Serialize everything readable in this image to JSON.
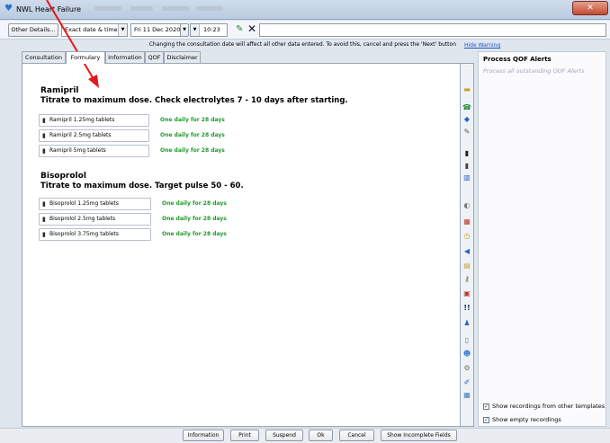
{
  "window": {
    "title": "NWL Heart Failure",
    "close_label": "✕"
  },
  "toolbar": {
    "other_details": "Other Details...",
    "date_type": "Exact date & time",
    "date": "Fri 11 Dec 2020",
    "time": "10:23"
  },
  "warning": {
    "text": "Changing the consultation date will affect all other data entered. To avoid this, cancel and press the 'Next' button",
    "hide_link": "Hide Warning"
  },
  "tabs": [
    {
      "label": "Consultation"
    },
    {
      "label": "Formulary"
    },
    {
      "label": "Information"
    },
    {
      "label": "QOF"
    },
    {
      "label": "Disclaimer"
    }
  ],
  "sections": [
    {
      "name": "Ramipril",
      "instruction": "Titrate to maximum dose. Check electrolytes 7 - 10 days after starting.",
      "drugs": [
        {
          "name": "Ramipril 1.25mg tablets",
          "dose": "One daily for 28 days"
        },
        {
          "name": "Ramipril 2.5mg tablets",
          "dose": "One daily for 28 days"
        },
        {
          "name": "Ramipril 5mg tablets",
          "dose": "One daily for 28 days"
        }
      ]
    },
    {
      "name": "Bisoprolol",
      "instruction": "Titrate to maximum dose. Target pulse 50 - 60.",
      "drugs": [
        {
          "name": "Bisoprolol 1.25mg tablets",
          "dose": "One daily for 28 days"
        },
        {
          "name": "Bisoprolol 2.5mg tablets",
          "dose": "One daily for 28 days"
        },
        {
          "name": "Bisoprolol 3.75mg tablets",
          "dose": "One daily for 28 days"
        }
      ]
    }
  ],
  "right_panel": {
    "title": "Process QOF Alerts",
    "subtitle": "Process all outstanding QOF Alerts",
    "show_other_templates": "Show recordings from other templates",
    "show_empty": "Show empty recordings"
  },
  "bottom_buttons": [
    {
      "label": "Information"
    },
    {
      "label": "Print"
    },
    {
      "label": "Suspend"
    },
    {
      "label": "Ok"
    },
    {
      "label": "Cancel"
    },
    {
      "label": "Show Incomplete Fields"
    }
  ],
  "colors": {
    "dose_green": "#1e9b2a",
    "arrow_red": "#e11b1b",
    "link_blue": "#1a55c0"
  }
}
